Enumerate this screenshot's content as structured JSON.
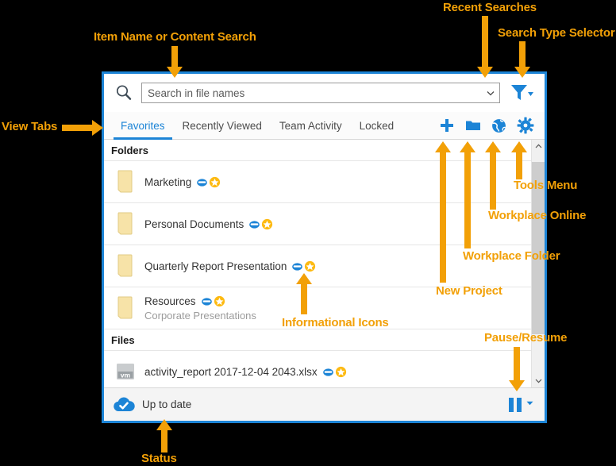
{
  "theme": {
    "background": "#000000",
    "accent_blue": "#1C84D6",
    "annotation_orange": "#F2A007",
    "star_yellow": "#FDBA12",
    "folder_yellow": "#F5DFA0",
    "muted_text": "#9b9b9b"
  },
  "annotations": [
    {
      "id": "item-name-or-content-search",
      "label": "Item Name or Content Search"
    },
    {
      "id": "recent-searches",
      "label": "Recent Searches"
    },
    {
      "id": "search-type-selector",
      "label": "Search Type Selector"
    },
    {
      "id": "view-tabs",
      "label": "View Tabs"
    },
    {
      "id": "tools-menu",
      "label": "Tools Menu"
    },
    {
      "id": "workplace-online",
      "label": "Workplace Online"
    },
    {
      "id": "workplace-folder",
      "label": "Workplace Folder"
    },
    {
      "id": "new-project",
      "label": "New Project"
    },
    {
      "id": "informational-icons",
      "label": "Informational Icons"
    },
    {
      "id": "pause-resume",
      "label": "Pause/Resume"
    },
    {
      "id": "status",
      "label": "Status"
    }
  ],
  "search": {
    "placeholder": "Search in file names",
    "value": "",
    "icon": "search-icon",
    "recent_searches_icon": "chevron-down-icon",
    "filter_icon": "funnel-filter-icon",
    "filter_caret_icon": "caret-down-icon"
  },
  "tabs": [
    {
      "label": "Favorites",
      "active": true
    },
    {
      "label": "Recently Viewed",
      "active": false
    },
    {
      "label": "Team Activity",
      "active": false
    },
    {
      "label": "Locked",
      "active": false
    }
  ],
  "toolbar_icons": [
    {
      "name": "plus-icon",
      "title": "New Project"
    },
    {
      "name": "folder-icon",
      "title": "Workplace Folder"
    },
    {
      "name": "globe-icon",
      "title": "Workplace Online"
    },
    {
      "name": "gear-icon",
      "title": "Tools Menu"
    }
  ],
  "list": {
    "folders_header": "Folders",
    "files_header": "Files",
    "folders": [
      {
        "name": "Marketing",
        "subtitle": "",
        "icon": "folder-icon",
        "badges": [
          "cloud-icon",
          "star-icon"
        ]
      },
      {
        "name": "Personal Documents",
        "subtitle": "",
        "icon": "folder-icon",
        "badges": [
          "cloud-icon",
          "star-icon"
        ]
      },
      {
        "name": "Quarterly Report Presentation",
        "subtitle": "",
        "icon": "folder-icon",
        "badges": [
          "cloud-icon",
          "star-icon"
        ]
      },
      {
        "name": "Resources",
        "subtitle": "Corporate Presentations",
        "icon": "folder-icon",
        "badges": [
          "cloud-icon",
          "star-icon"
        ]
      }
    ],
    "files": [
      {
        "name": "activity_report 2017-12-04 2043.xlsx",
        "subtitle": "",
        "icon": "xlsx-file-icon",
        "badges": [
          "cloud-icon",
          "star-icon"
        ]
      }
    ]
  },
  "scrollbar": {
    "up_icon": "chevron-up-icon",
    "down_icon": "chevron-down-icon"
  },
  "status_bar": {
    "icon": "cloud-check-icon",
    "text": "Up to date",
    "pause_icon": "pause-icon",
    "pause_caret_icon": "caret-down-icon"
  }
}
